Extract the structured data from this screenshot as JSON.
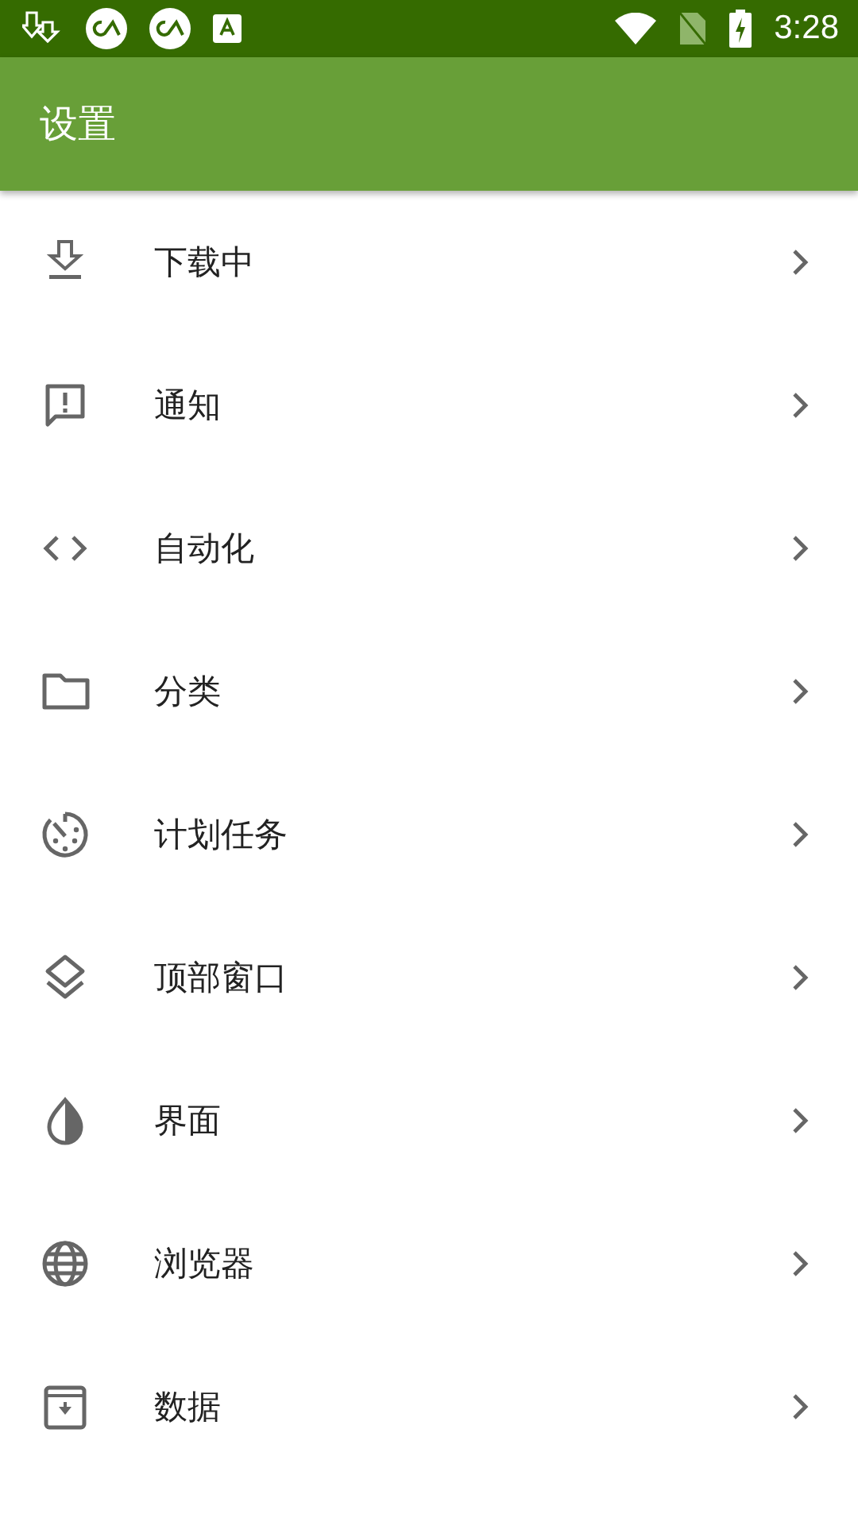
{
  "status_bar": {
    "time": "3:28"
  },
  "app_bar": {
    "title": "设置"
  },
  "items": [
    {
      "kind": "download",
      "label": "下载中"
    },
    {
      "kind": "notification",
      "label": "通知"
    },
    {
      "kind": "code",
      "label": "自动化"
    },
    {
      "kind": "folder",
      "label": "分类"
    },
    {
      "kind": "timer",
      "label": "计划任务"
    },
    {
      "kind": "layers",
      "label": "顶部窗口"
    },
    {
      "kind": "contrast",
      "label": "界面"
    },
    {
      "kind": "globe",
      "label": "浏览器"
    },
    {
      "kind": "archive",
      "label": "数据"
    }
  ]
}
